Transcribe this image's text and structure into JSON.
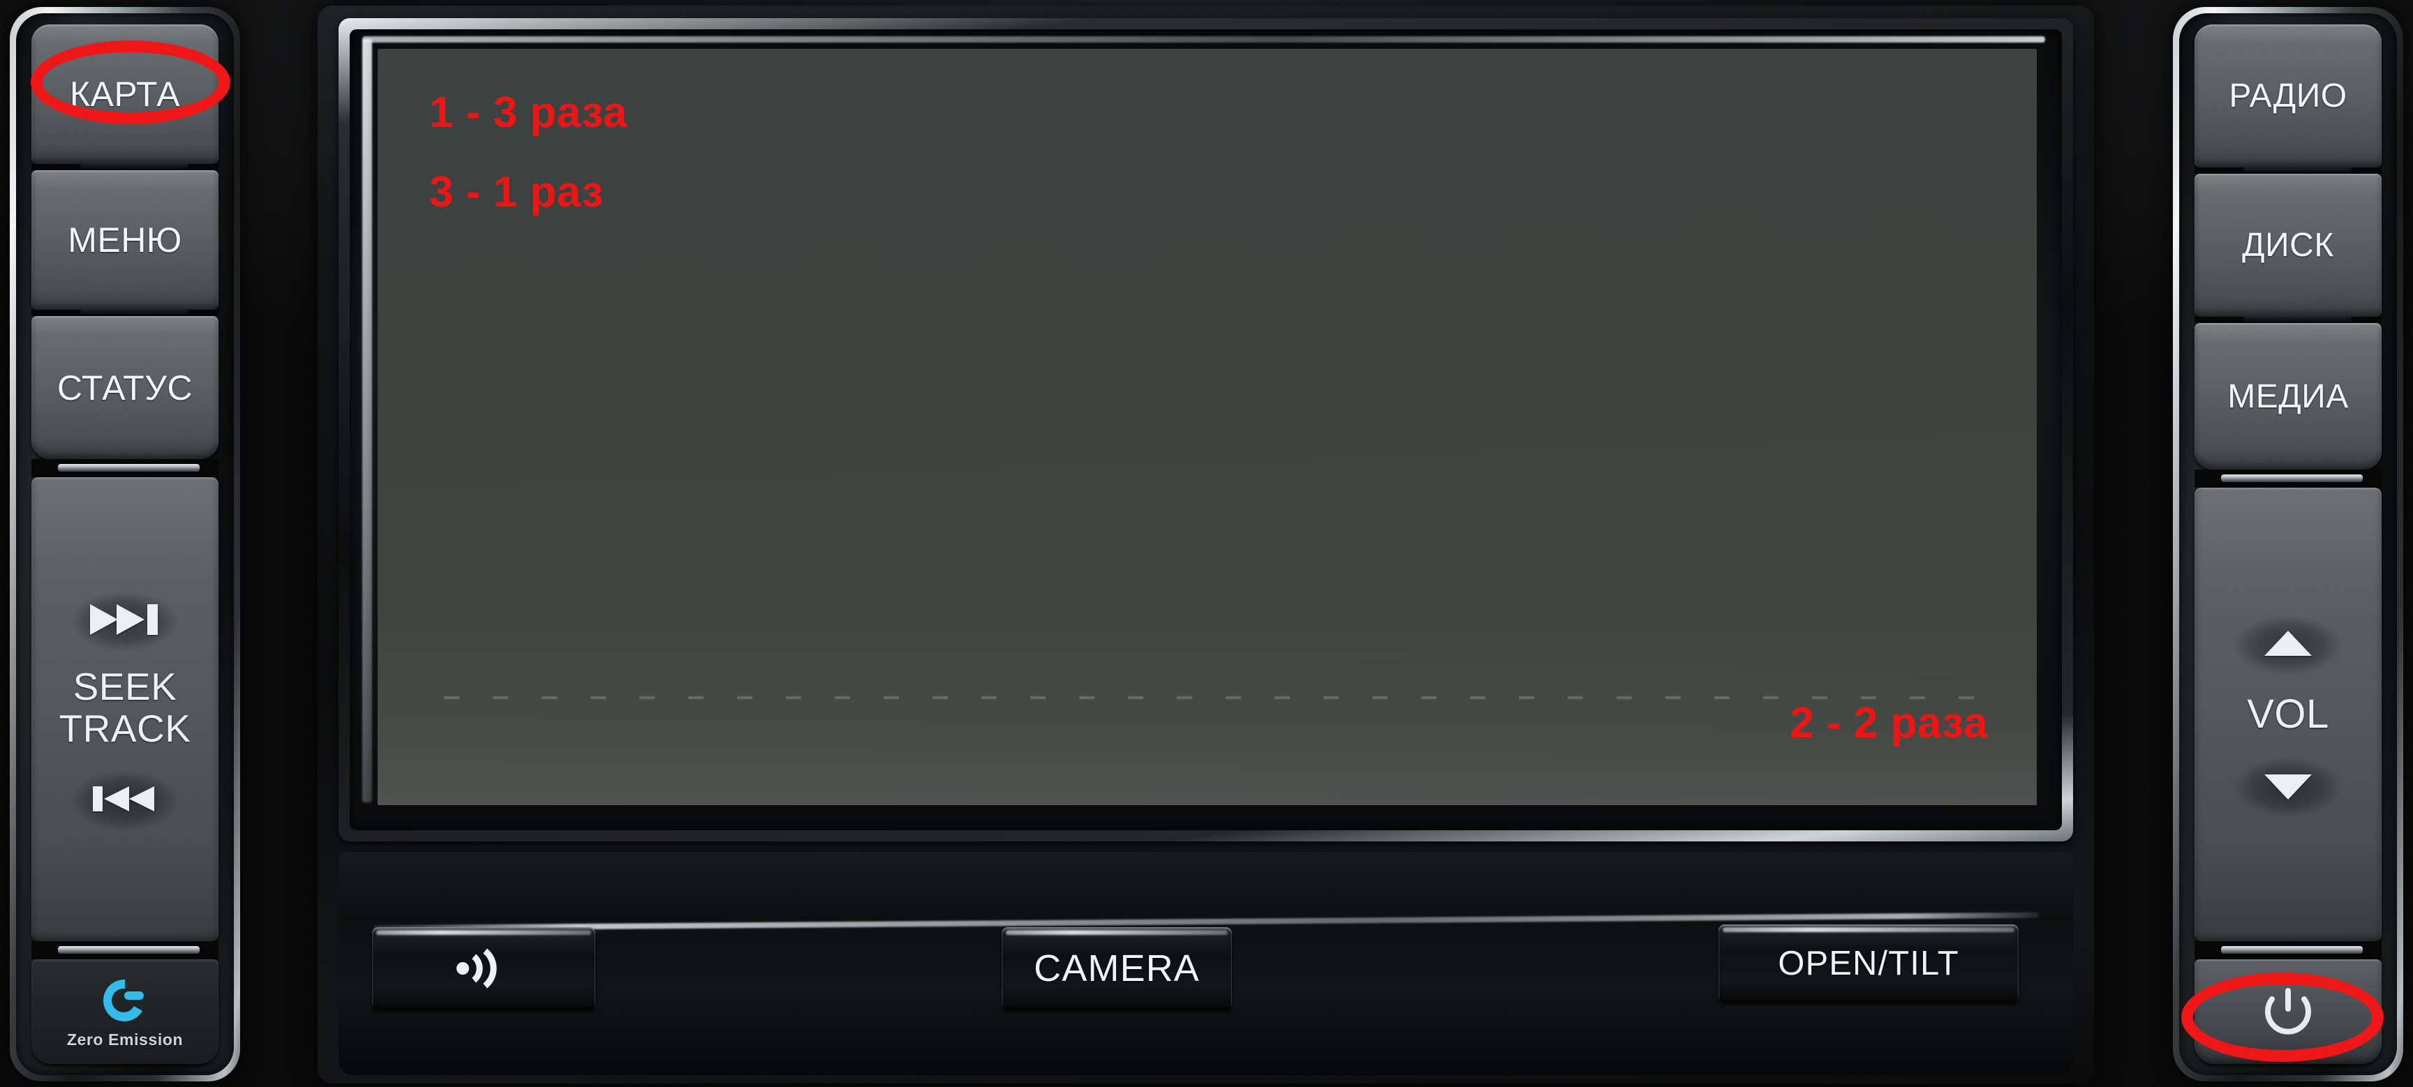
{
  "device": {
    "type": "car-head-unit",
    "brand_badge": "Zero Emission",
    "screen_color": "#3e4340",
    "annotation_color": "#f01515",
    "bezel_chrome": "#e9ecee"
  },
  "left_panel": {
    "keys": [
      {
        "id": "karta",
        "label": "КАРТА",
        "highlighted": true
      },
      {
        "id": "menyu",
        "label": "МЕНЮ",
        "highlighted": false
      },
      {
        "id": "status",
        "label": "СТАТУС",
        "highlighted": false
      }
    ],
    "rocker": {
      "up_icon": "skip-forward-icon",
      "down_icon": "skip-backward-icon",
      "label_line1": "SEEK",
      "label_line2": "TRACK"
    },
    "badge": {
      "icon": "zero-emission-e-icon",
      "icon_color": "#35bcea",
      "label": "Zero Emission"
    }
  },
  "right_panel": {
    "keys": [
      {
        "id": "radio",
        "label": "РАДИО"
      },
      {
        "id": "disk",
        "label": "ДИСК"
      },
      {
        "id": "media",
        "label": "МЕДИА"
      }
    ],
    "rocker": {
      "up_icon": "triangle-up-icon",
      "down_icon": "triangle-down-icon",
      "label": "VOL"
    },
    "power": {
      "id": "power",
      "icon": "power-icon",
      "highlighted": true
    }
  },
  "screen": {
    "state": "off",
    "annotations": [
      {
        "id": "note-1",
        "text": "1 - 3 раза",
        "position": "top-left"
      },
      {
        "id": "note-2",
        "text": "3 - 1 раз",
        "position": "top-left"
      },
      {
        "id": "note-3",
        "text": "2 - 2 раза",
        "position": "bottom-right"
      }
    ]
  },
  "bottom_bar": {
    "buttons": [
      {
        "id": "voice",
        "label": "",
        "icon": "voice-command-icon"
      },
      {
        "id": "camera",
        "label": "CAMERA",
        "icon": ""
      },
      {
        "id": "open",
        "label": "OPEN/TILT",
        "icon": ""
      }
    ]
  }
}
